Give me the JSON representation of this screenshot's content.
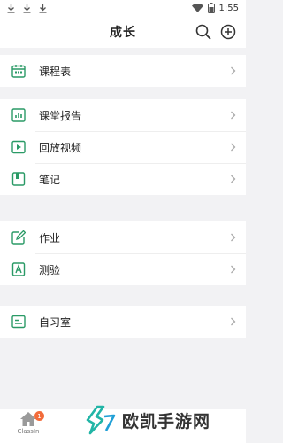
{
  "status_bar": {
    "time": "1:55",
    "icons": [
      "download-icon",
      "download-icon",
      "download-icon",
      "wifi-icon",
      "battery-icon"
    ]
  },
  "header": {
    "title": "成长",
    "actions": [
      "search-icon",
      "add-icon"
    ]
  },
  "sections": [
    {
      "items": [
        {
          "label": "课程表",
          "icon": "calendar-icon"
        }
      ]
    },
    {
      "items": [
        {
          "label": "课堂报告",
          "icon": "report-chart-icon"
        },
        {
          "label": "回放视频",
          "icon": "play-video-icon"
        },
        {
          "label": "笔记",
          "icon": "notebook-icon"
        }
      ]
    },
    {
      "items": [
        {
          "label": "作业",
          "icon": "edit-homework-icon"
        },
        {
          "label": "测验",
          "icon": "quiz-icon"
        }
      ]
    },
    {
      "items": [
        {
          "label": "自习室",
          "icon": "study-room-icon"
        }
      ]
    }
  ],
  "bottom_tab": {
    "label": "ClassIn",
    "badge": "1",
    "icon": "home-icon"
  },
  "watermark": {
    "text": "欧凯手游网"
  },
  "colors": {
    "accent": "#2a9a66",
    "badge": "#f26b3a"
  }
}
